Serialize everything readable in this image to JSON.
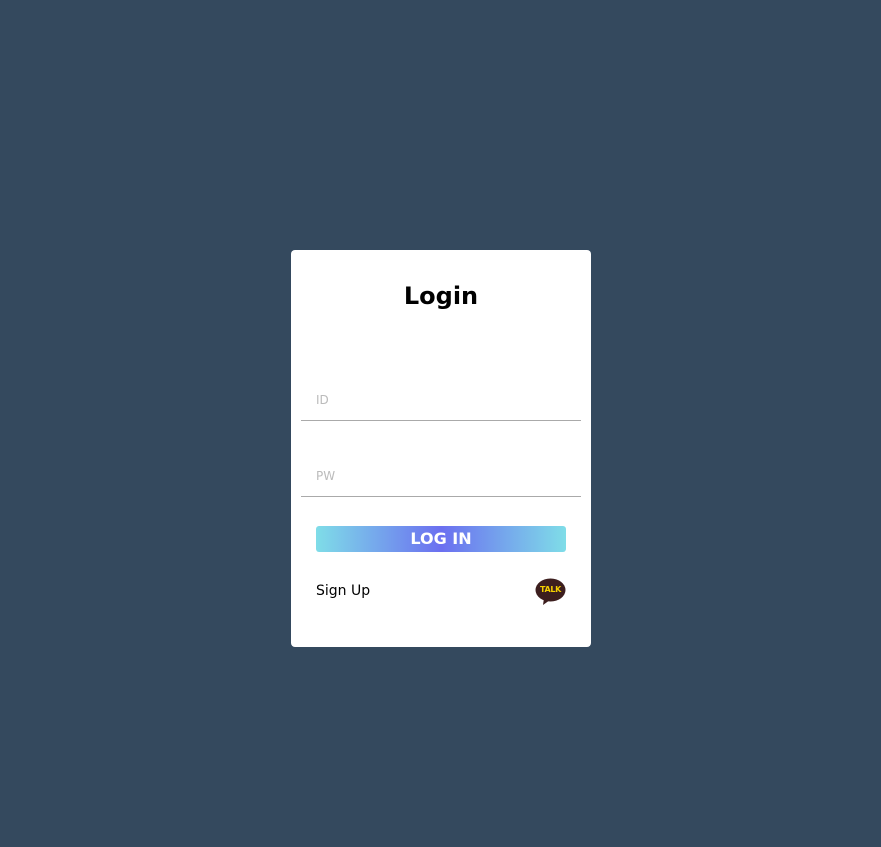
{
  "login_card": {
    "title": "Login",
    "id_field": {
      "placeholder": "ID",
      "value": ""
    },
    "pw_field": {
      "placeholder": "PW",
      "value": ""
    },
    "login_button_label": "LOG IN",
    "signup_link": "Sign Up",
    "kakao_badge_text": "TALK",
    "kakao_icon": "kakao-talk-icon"
  },
  "colors": {
    "background": "#34495e",
    "card": "#ffffff",
    "button_gradient_start": "#7fdde8",
    "button_gradient_mid": "#6b6ff0",
    "kakao_bubble": "#3c1e1e",
    "kakao_text": "#f5d000"
  }
}
